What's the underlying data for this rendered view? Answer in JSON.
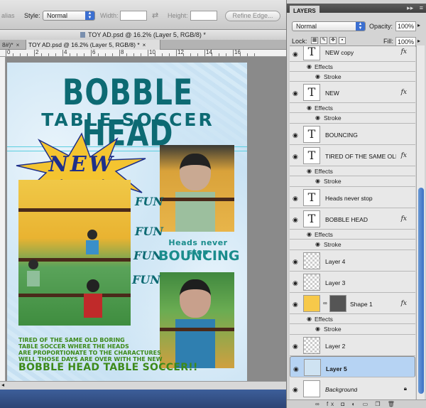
{
  "options_bar": {
    "alias_label": "alias",
    "style_label": "Style:",
    "style_value": "Normal",
    "width_label": "Width:",
    "height_label": "Height:",
    "refine_edge_label": "Refine Edge..."
  },
  "document": {
    "window_title": "TOY AD.psd @ 16.2% (Layer 5, RGB/8) *",
    "tabs": [
      {
        "label": "8#)*",
        "active": false
      },
      {
        "label": "TOY AD.psd @ 16.2% (Layer 5, RGB/8) *",
        "active": true
      }
    ],
    "ruler_numbers": [
      "0",
      "2",
      "4",
      "6",
      "8",
      "10",
      "12",
      "14",
      "16"
    ]
  },
  "poster": {
    "title_line1": "BOBBLE HEAD",
    "title_line2": "TABLE SOCCER",
    "badge": "NEW",
    "fun_labels": [
      "FUN",
      "FUN",
      "FUN",
      "FUN"
    ],
    "heads_never_stop": "Heads never stop",
    "bouncing": "BOUNCING",
    "body_lines": [
      "TIRED OF THE SAME OLD BORING",
      "TABLE SOCCER WHERE THE HEADS",
      "ARE PROPORTIONATE TO THE CHARACTURES",
      "WELL THOSE DAYS ARE OVER WITH THE NEW"
    ],
    "cta": "BOBBLE HEAD TABLE SOCCER!!"
  },
  "layers_panel": {
    "tab_label": "LAYERS",
    "blend_mode": "Normal",
    "opacity_label": "Opacity:",
    "opacity_value": "100%",
    "lock_label": "Lock:",
    "fill_label": "Fill:",
    "fill_value": "100%",
    "effects_label": "Effects",
    "stroke_label": "Stroke",
    "fx_label": "fx",
    "layers": [
      {
        "name": "NEW copy"
      },
      {
        "name": "NEW"
      },
      {
        "name": "BOUNCING"
      },
      {
        "name": "TIRED OF THE SAME OLD B..."
      },
      {
        "name": "Heads never stop"
      },
      {
        "name": "BOBBLE HEAD"
      },
      {
        "name": "Layer 4"
      },
      {
        "name": "Layer 3"
      },
      {
        "name": "Shape 1"
      },
      {
        "name": "Layer 2"
      },
      {
        "name": "Layer 5"
      },
      {
        "name": "Background"
      }
    ]
  },
  "colors": {
    "title_teal": "#0d6a73",
    "copy_green": "#3d8a1a",
    "selection_blue": "#b6d3f3",
    "star_yellow": "#f4c430"
  }
}
